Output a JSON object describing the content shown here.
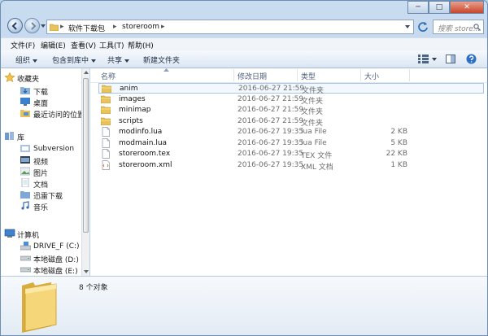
{
  "window": {
    "controls": {
      "minimize": "─",
      "maximize": "□",
      "close": "✕"
    }
  },
  "address": {
    "segments": [
      "软件下载包",
      "storeroom"
    ],
    "search_placeholder": "搜索 store..."
  },
  "menu": [
    "文件(F)",
    "编辑(E)",
    "查看(V)",
    "工具(T)",
    "帮助(H)"
  ],
  "toolbar": {
    "organize": "组织",
    "include": "包含到库中",
    "share": "共享",
    "new_folder": "新建文件夹"
  },
  "nav": {
    "favorites": {
      "header": "收藏夹",
      "items": [
        "下载",
        "桌面",
        "最近访问的位置"
      ]
    },
    "libraries": {
      "header": "库",
      "items": [
        "Subversion",
        "视频",
        "图片",
        "文档",
        "迅雷下载",
        "音乐"
      ]
    },
    "computer": {
      "header": "计算机",
      "items": [
        "DRIVE_F (C:)",
        "本地磁盘 (D:)",
        "本地磁盘 (E:)"
      ]
    }
  },
  "columns": {
    "name": "名称",
    "date": "修改日期",
    "type": "类型",
    "size": "大小"
  },
  "files": [
    {
      "name": "anim",
      "date": "2016-06-27 21:59",
      "type": "文件夹",
      "size": "",
      "kind": "folder"
    },
    {
      "name": "images",
      "date": "2016-06-27 21:59",
      "type": "文件夹",
      "size": "",
      "kind": "folder"
    },
    {
      "name": "minimap",
      "date": "2016-06-27 21:59",
      "type": "文件夹",
      "size": "",
      "kind": "folder"
    },
    {
      "name": "scripts",
      "date": "2016-06-27 21:59",
      "type": "文件夹",
      "size": "",
      "kind": "folder"
    },
    {
      "name": "modinfo.lua",
      "date": "2016-06-27 19:35",
      "type": "lua File",
      "size": "2 KB",
      "kind": "file"
    },
    {
      "name": "modmain.lua",
      "date": "2016-06-27 19:35",
      "type": "lua File",
      "size": "5 KB",
      "kind": "file"
    },
    {
      "name": "storeroom.tex",
      "date": "2016-06-27 19:35",
      "type": "TEX 文件",
      "size": "22 KB",
      "kind": "file"
    },
    {
      "name": "storeroom.xml",
      "date": "2016-06-27 19:35",
      "type": "XML 文档",
      "size": "1 KB",
      "kind": "xml"
    }
  ],
  "status": {
    "count": "8 个对象"
  }
}
